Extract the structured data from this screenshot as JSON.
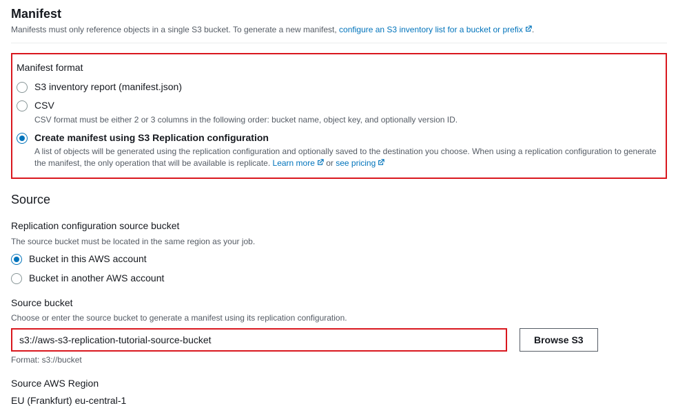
{
  "header": {
    "title": "Manifest",
    "desc_prefix": "Manifests must only reference objects in a single S3 bucket. To generate a new manifest, ",
    "desc_link": "configure an S3 inventory list for a bucket or prefix",
    "desc_suffix": "."
  },
  "manifest_format": {
    "label": "Manifest format",
    "options": {
      "inventory": {
        "label": "S3 inventory report (manifest.json)"
      },
      "csv": {
        "label": "CSV",
        "desc": "CSV format must be either 2 or 3 columns in the following order: bucket name, object key, and optionally version ID."
      },
      "replication": {
        "label": "Create manifest using S3 Replication configuration",
        "desc_prefix": "A list of objects will be generated using the replication configuration and optionally saved to the destination you choose. When using a replication configuration to generate the manifest, the only operation that will be available is replicate. ",
        "learn_more": "Learn more",
        "or_text": " or ",
        "pricing": "see pricing"
      }
    }
  },
  "source": {
    "title": "Source",
    "config_source": {
      "label": "Replication configuration source bucket",
      "desc": "The source bucket must be located in the same region as your job.",
      "this_account": "Bucket in this AWS account",
      "other_account": "Bucket in another AWS account"
    },
    "bucket": {
      "label": "Source bucket",
      "desc": "Choose or enter the source bucket to generate a manifest using its replication configuration.",
      "value": "s3://aws-s3-replication-tutorial-source-bucket",
      "browse": "Browse S3",
      "format_hint": "Format: s3://bucket"
    },
    "region": {
      "label": "Source AWS Region",
      "value": "EU (Frankfurt) eu-central-1"
    }
  }
}
